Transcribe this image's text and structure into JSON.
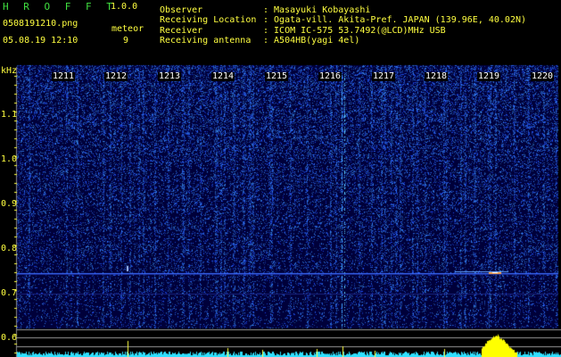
{
  "app": {
    "title": "H R O F F T",
    "version": "1.0.0"
  },
  "file": {
    "name": "0508191210.png",
    "datetime": "05.08.19 12:10"
  },
  "meteor": {
    "label": "meteor",
    "count": "9"
  },
  "info": {
    "observer_label": "Observer",
    "observer_value": ": Masayuki Kobayashi",
    "location_label": "Receiving Location",
    "location_value": ": Ogata-vill. Akita-Pref. JAPAN (139.96E, 40.02N)",
    "receiver_label": "Receiver",
    "receiver_value": ": ICOM IC-575 53.7492(@LCD)MHz USB",
    "antenna_label": "Receiving antenna",
    "antenna_value": ": A504HB(yagi 4el)"
  },
  "axis": {
    "unit": "kHz",
    "freq_ticks": [
      "1.1",
      "1.0",
      "0.9",
      "0.8",
      "0.7",
      "0.6"
    ],
    "minutes": [
      "1211",
      "1212",
      "1213",
      "1214",
      "1215",
      "1216",
      "1217",
      "1218",
      "1219",
      "1220"
    ]
  },
  "colors": {
    "background": "#000000",
    "header_text": "#ffff40",
    "title": "#40e040",
    "spectrum": "#2a4cff",
    "profile": "#30e0ff",
    "peak": "#ffff00"
  }
}
